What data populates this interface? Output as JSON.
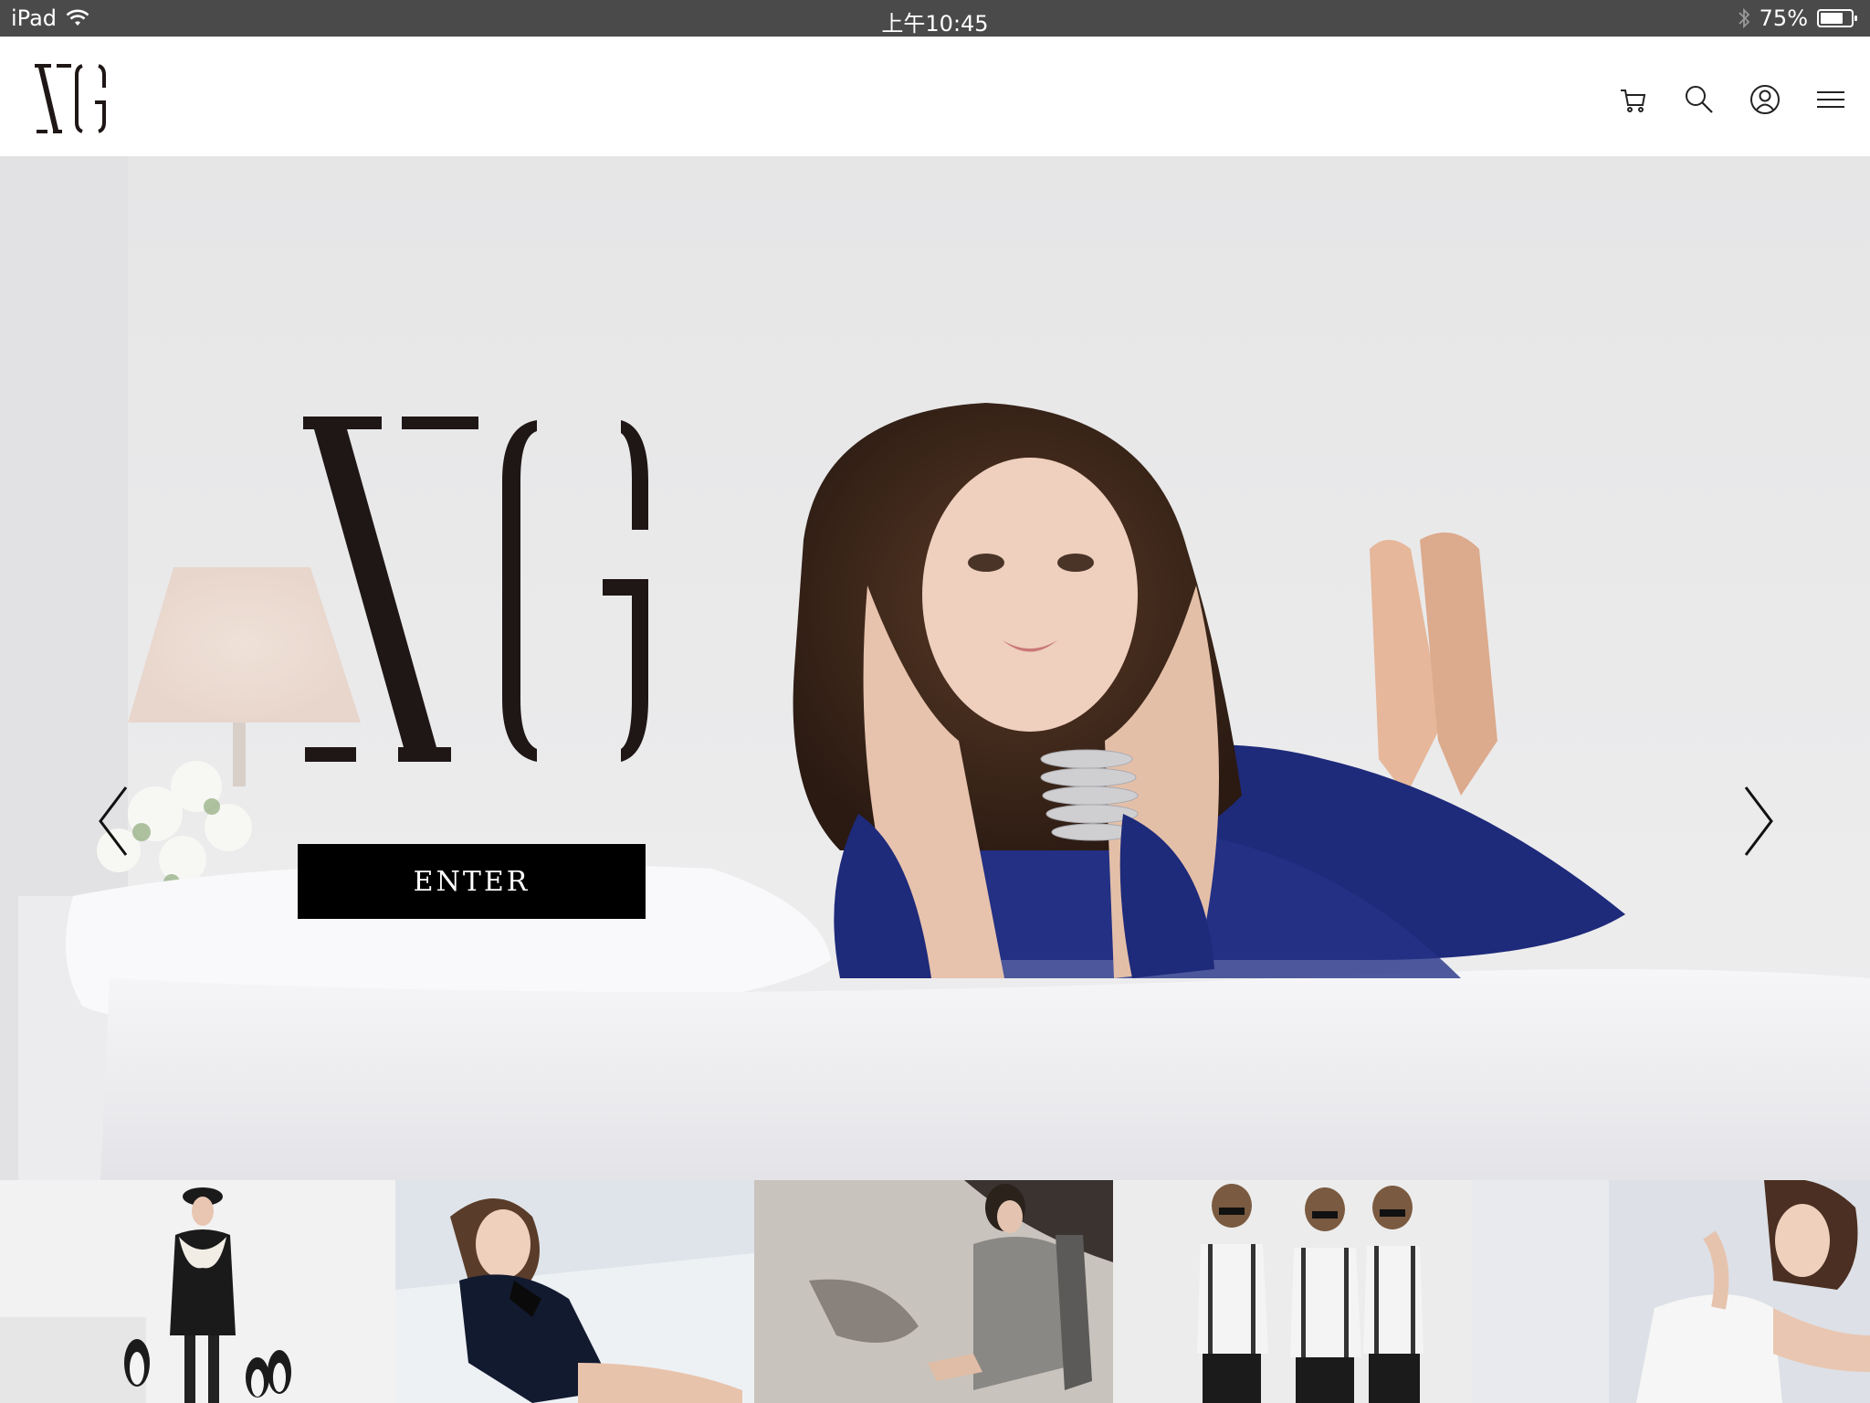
{
  "status_bar": {
    "device": "iPad",
    "time": "上午10:45",
    "battery": "75%",
    "battery_level": 0.75
  },
  "header": {
    "logo_text": "XG",
    "actions": [
      {
        "name": "cart-icon"
      },
      {
        "name": "search-icon"
      },
      {
        "name": "account-icon"
      },
      {
        "name": "menu-icon"
      }
    ]
  },
  "hero": {
    "logo_text": "XG",
    "enter_label": "ENTER"
  },
  "thumbnails": [
    {
      "name": "thumbnail-1"
    },
    {
      "name": "thumbnail-2"
    },
    {
      "name": "thumbnail-3"
    },
    {
      "name": "thumbnail-4"
    },
    {
      "name": "thumbnail-5"
    }
  ],
  "colors": {
    "status_bar_bg": "#4a4a4a",
    "header_bg": "#ffffff",
    "brand_dark": "#1f1616",
    "button_bg": "#000000",
    "dress_blue": "#1e2a7a"
  }
}
